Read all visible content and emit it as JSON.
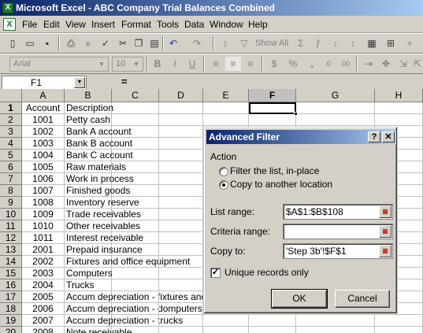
{
  "window": {
    "title": "Microsoft Excel - ABC Company Trial Balances Combined"
  },
  "menu": [
    "File",
    "Edit",
    "View",
    "Insert",
    "Format",
    "Tools",
    "Data",
    "Window",
    "Help"
  ],
  "toolbar1": {
    "show_all": "Show All"
  },
  "toolbar2": {
    "font": "Arial",
    "size": "10",
    "bold": "B",
    "italic": "I",
    "underline": "U",
    "currency": "$",
    "percent": "%",
    "comma": ","
  },
  "formula_bar": {
    "name_box": "F1",
    "equals": "=",
    "formula": ""
  },
  "columns": [
    "A",
    "B",
    "C",
    "D",
    "E",
    "F",
    "G",
    "H"
  ],
  "active_column": "F",
  "active_row": "1",
  "rows": [
    {
      "n": "1",
      "a": "Account",
      "b": "Description"
    },
    {
      "n": "2",
      "a": "1001",
      "b": "Petty cash"
    },
    {
      "n": "3",
      "a": "1002",
      "b": "Bank A account"
    },
    {
      "n": "4",
      "a": "1003",
      "b": "Bank B account"
    },
    {
      "n": "5",
      "a": "1004",
      "b": "Bank C account"
    },
    {
      "n": "6",
      "a": "1005",
      "b": "Raw materials"
    },
    {
      "n": "7",
      "a": "1006",
      "b": "Work in process"
    },
    {
      "n": "8",
      "a": "1007",
      "b": "Finished goods"
    },
    {
      "n": "9",
      "a": "1008",
      "b": "Inventory reserve"
    },
    {
      "n": "10",
      "a": "1009",
      "b": "Trade receivables"
    },
    {
      "n": "11",
      "a": "1010",
      "b": "Other receivables"
    },
    {
      "n": "12",
      "a": "1011",
      "b": "Interest receivable"
    },
    {
      "n": "13",
      "a": "2001",
      "b": "Prepaid insurance"
    },
    {
      "n": "14",
      "a": "2002",
      "b": "Fixtures and office equipment"
    },
    {
      "n": "15",
      "a": "2003",
      "b": "Computers"
    },
    {
      "n": "16",
      "a": "2004",
      "b": "Trucks"
    },
    {
      "n": "17",
      "a": "2005",
      "b": "Accum depreciation - fixtures and"
    },
    {
      "n": "18",
      "a": "2006",
      "b": "Accum depreciation - domputers"
    },
    {
      "n": "19",
      "a": "2007",
      "b": "Accum depreciation - trucks"
    },
    {
      "n": "20",
      "a": "2008",
      "b": "Note receivable"
    }
  ],
  "dialog": {
    "title": "Advanced Filter",
    "help": "?",
    "close": "✕",
    "action_label": "Action",
    "option_filter": "Filter the list, in-place",
    "option_copy": "Copy to another location",
    "selected_option": "copy",
    "list_range_label": "List range:",
    "list_range_value": "$A$1:$B$108",
    "criteria_range_label": "Criteria range:",
    "criteria_range_value": "",
    "copy_to_label": "Copy to:",
    "copy_to_value": "'Step 3b'!$F$1",
    "unique_label": "Unique records only",
    "unique_checked": true,
    "ok": "OK",
    "cancel": "Cancel"
  }
}
